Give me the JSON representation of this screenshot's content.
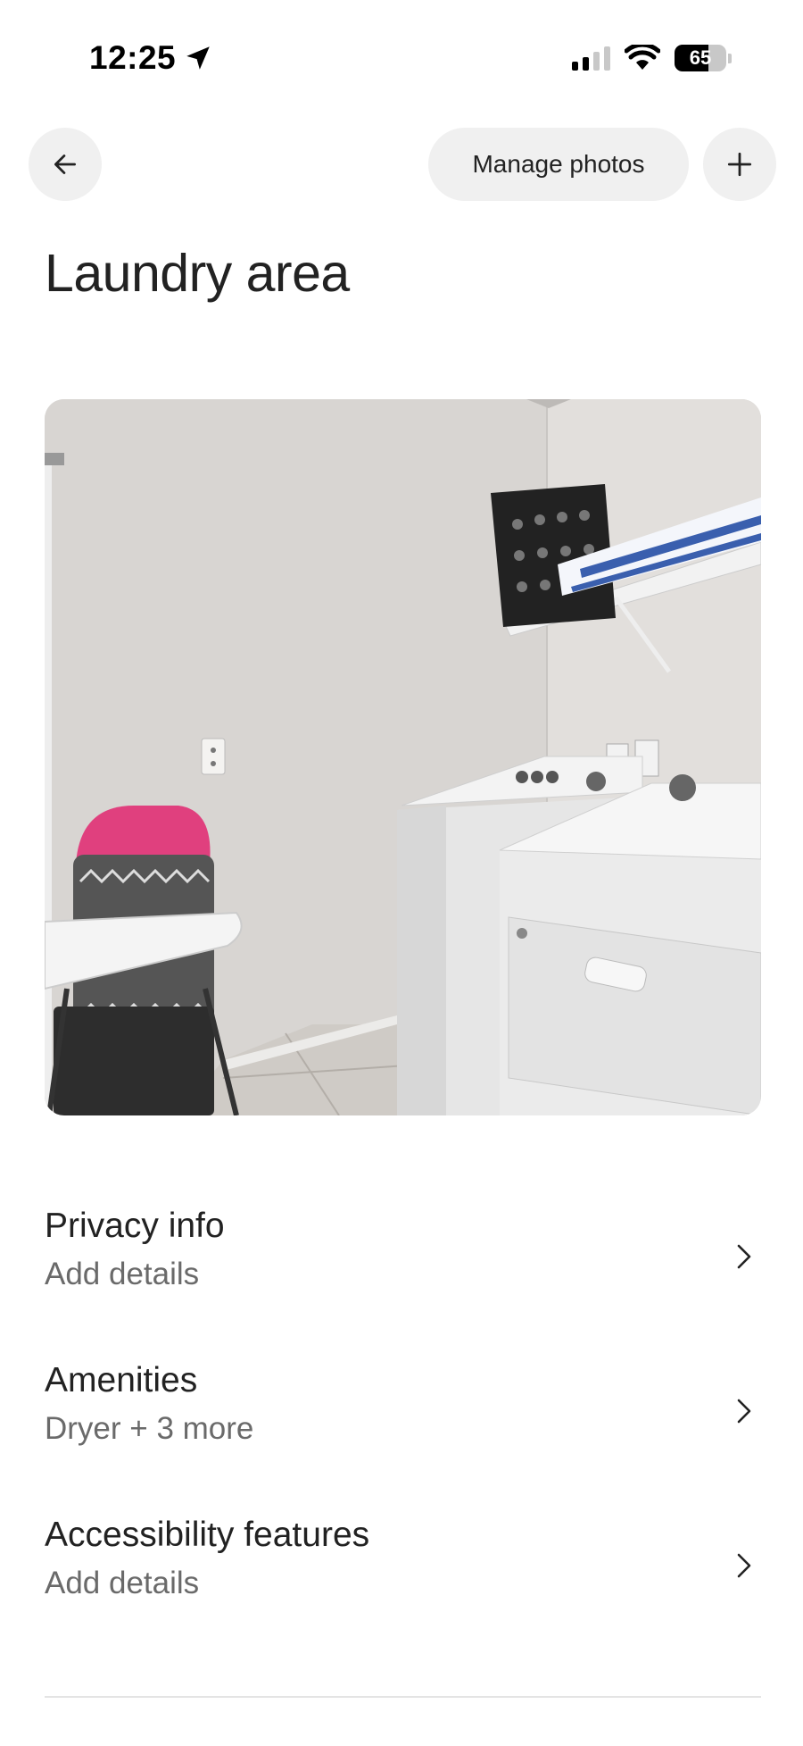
{
  "status_bar": {
    "time": "12:25",
    "battery": "65",
    "battery_level": 0.65
  },
  "nav": {
    "back_icon": "arrow-left-icon",
    "manage_photos_label": "Manage photos",
    "add_icon": "plus-icon"
  },
  "page": {
    "title": "Laundry area"
  },
  "sections": [
    {
      "title": "Privacy info",
      "subtitle": "Add details"
    },
    {
      "title": "Amenities",
      "subtitle": "Dryer + 3 more"
    },
    {
      "title": "Accessibility features",
      "subtitle": "Add details"
    }
  ],
  "colors": {
    "text_primary": "#222222",
    "text_secondary": "#6a6a6a",
    "button_bg": "#f0f0f0",
    "divider": "#e4e4e4"
  }
}
